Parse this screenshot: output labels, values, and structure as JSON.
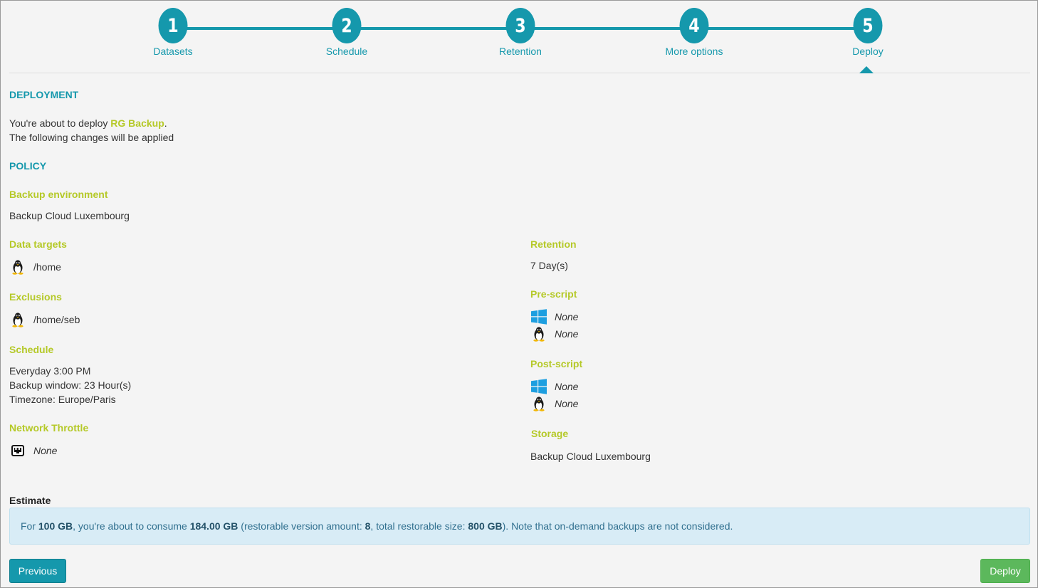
{
  "wizard": {
    "steps": [
      {
        "number": "1",
        "label": "Datasets"
      },
      {
        "number": "2",
        "label": "Schedule"
      },
      {
        "number": "3",
        "label": "Retention"
      },
      {
        "number": "4",
        "label": "More options"
      },
      {
        "number": "5",
        "label": "Deploy"
      }
    ],
    "active_step": 5
  },
  "deployment": {
    "title": "DEPLOYMENT",
    "intro_prefix": "You're about to deploy ",
    "policy_name": "RG Backup",
    "intro_suffix": ".",
    "changes_text": "The following changes will be applied"
  },
  "policy": {
    "title": "POLICY",
    "backup_environment": {
      "label": "Backup environment",
      "value": "Backup Cloud Luxembourg"
    },
    "data_targets": {
      "label": "Data targets",
      "items": [
        {
          "icon": "linux-icon",
          "value": "/home"
        }
      ]
    },
    "exclusions": {
      "label": "Exclusions",
      "items": [
        {
          "icon": "linux-icon",
          "value": "/home/seb"
        }
      ]
    },
    "schedule": {
      "label": "Schedule",
      "lines": [
        "Everyday 3:00 PM",
        "Backup window: 23 Hour(s)",
        "Timezone: Europe/Paris"
      ]
    },
    "network_throttle": {
      "label": "Network Throttle",
      "items": [
        {
          "icon": "network-port-icon",
          "value": "None"
        }
      ]
    },
    "retention": {
      "label": "Retention",
      "value": "7 Day(s)"
    },
    "pre_script": {
      "label": "Pre-script",
      "items": [
        {
          "icon": "windows-icon",
          "value": "None"
        },
        {
          "icon": "linux-icon",
          "value": "None"
        }
      ]
    },
    "post_script": {
      "label": "Post-script",
      "items": [
        {
          "icon": "windows-icon",
          "value": "None"
        },
        {
          "icon": "linux-icon",
          "value": "None"
        }
      ]
    },
    "storage": {
      "label": "Storage",
      "value": "Backup Cloud Luxembourg"
    }
  },
  "estimate": {
    "title": "Estimate",
    "t1": "For ",
    "size": "100 GB",
    "t2": ", you're about to consume ",
    "consume": "184.00 GB",
    "t3": " (restorable version amount: ",
    "versions": "8",
    "t4": ", total restorable size: ",
    "total": "800 GB",
    "t5": "). Note that on-demand backups are not considered."
  },
  "buttons": {
    "previous": "Previous",
    "deploy": "Deploy"
  },
  "colors": {
    "primary": "#1598ac",
    "accent": "#b5c928",
    "success": "#5cb85c",
    "info_bg": "#d8ecf6"
  }
}
